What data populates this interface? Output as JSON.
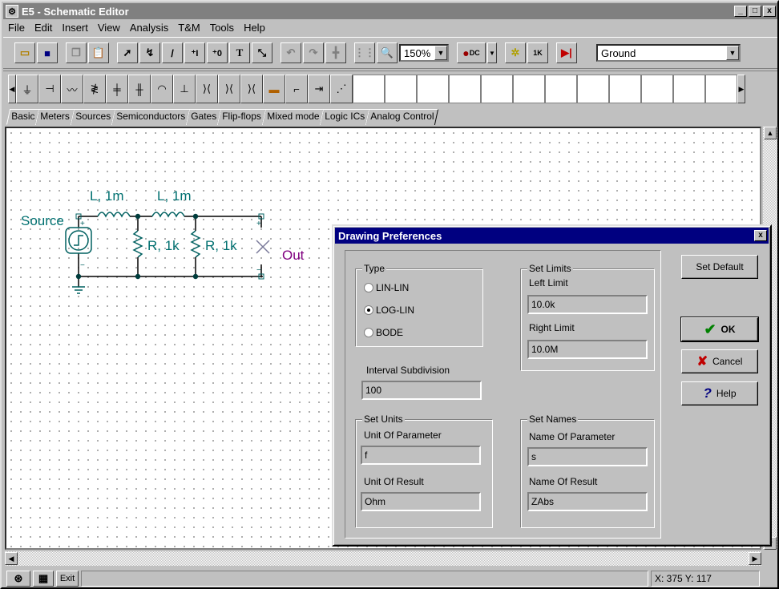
{
  "window": {
    "title": "E5 - Schematic Editor",
    "min_label": "_",
    "max_label": "□",
    "close_label": "x"
  },
  "menu": [
    "File",
    "Edit",
    "Insert",
    "View",
    "Analysis",
    "T&M",
    "Tools",
    "Help"
  ],
  "toolbar": {
    "zoom_value": "150%",
    "ground_select": "Ground",
    "dc_label": "DC",
    "k_label": "1K"
  },
  "tabs": [
    "Basic",
    "Meters",
    "Sources",
    "Semiconductors",
    "Gates",
    "Flip-flops",
    "Mixed mode",
    "Logic ICs",
    "Analog Control"
  ],
  "schematic": {
    "l1": "L, 1m",
    "l2": "L, 1m",
    "source": "Source",
    "r1": "R, 1k",
    "r2": "R, 1k",
    "out": "Out",
    "colors": {
      "label": "#007070",
      "out": "#800080",
      "wire": "#000000",
      "node": "#006060"
    }
  },
  "dialog": {
    "title": "Drawing Preferences",
    "close_label": "x",
    "type_group": "Type",
    "type_options": [
      {
        "label": "LIN-LIN",
        "selected": false
      },
      {
        "label": "LOG-LIN",
        "selected": true
      },
      {
        "label": "BODE",
        "selected": false
      }
    ],
    "limits_group": "Set Limits",
    "left_limit_label": "Left Limit",
    "left_limit_value": "10.0k",
    "right_limit_label": "Right Limit",
    "right_limit_value": "10.0M",
    "interval_label": "Interval Subdivision",
    "interval_value": "100",
    "units_group": "Set Units",
    "unit_param_label": "Unit Of Parameter",
    "unit_param_value": "f",
    "unit_result_label": "Unit Of Result",
    "unit_result_value": "Ohm",
    "names_group": "Set Names",
    "name_param_label": "Name Of Parameter",
    "name_param_value": "s",
    "name_result_label": "Name Of Result",
    "name_result_value": "ZAbs",
    "set_default": "Set Default",
    "ok": "OK",
    "cancel": "Cancel",
    "help": "Help"
  },
  "status": {
    "exit": "Exit",
    "coords": "X: 375 Y: 117"
  }
}
